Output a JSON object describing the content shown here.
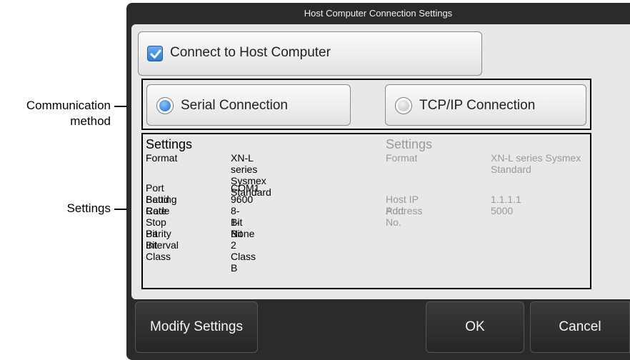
{
  "annotations": {
    "communication_method_line1": "Communication",
    "communication_method_line2": "method",
    "settings": "Settings"
  },
  "dialog": {
    "title": "Host Computer Connection Settings",
    "connect_checkbox": {
      "label": "Connect to Host Computer",
      "checked": true
    },
    "connection_methods": [
      {
        "label": "Serial Connection",
        "selected": true
      },
      {
        "label": "TCP/IP Connection",
        "selected": false
      }
    ],
    "serial_settings": {
      "heading": "Settings",
      "rows": [
        {
          "label": "Format",
          "value": "XN-L series Sysmex",
          "value2": "Standard"
        },
        {
          "label": "Port Setting",
          "value": "COM1"
        },
        {
          "label": "Baud Rate",
          "value": "9600"
        },
        {
          "label": "Code",
          "value": "8-Bit"
        },
        {
          "label": "Stop Bit",
          "value": "1-Bit"
        },
        {
          "label": "Parity Bit",
          "value": "None"
        },
        {
          "label": "Interval",
          "value": "2"
        },
        {
          "label": "Class",
          "value": "Class B"
        }
      ]
    },
    "tcpip_settings": {
      "heading": "Settings",
      "rows": [
        {
          "label": "Format",
          "value": "XN-L series Sysmex",
          "value2": "Standard"
        },
        {
          "label": "Host IP Address",
          "value": "1.1.1.1"
        },
        {
          "label": "Port No.",
          "value": "5000"
        }
      ]
    },
    "buttons": {
      "modify": "Modify Settings",
      "ok": "OK",
      "cancel": "Cancel"
    }
  },
  "colors": {
    "dialog_bg": "#2b2b2b",
    "panel_bg": "#e8e8e8",
    "accent_blue": "#2a7bd1",
    "disabled_text": "#9a9a9a"
  }
}
